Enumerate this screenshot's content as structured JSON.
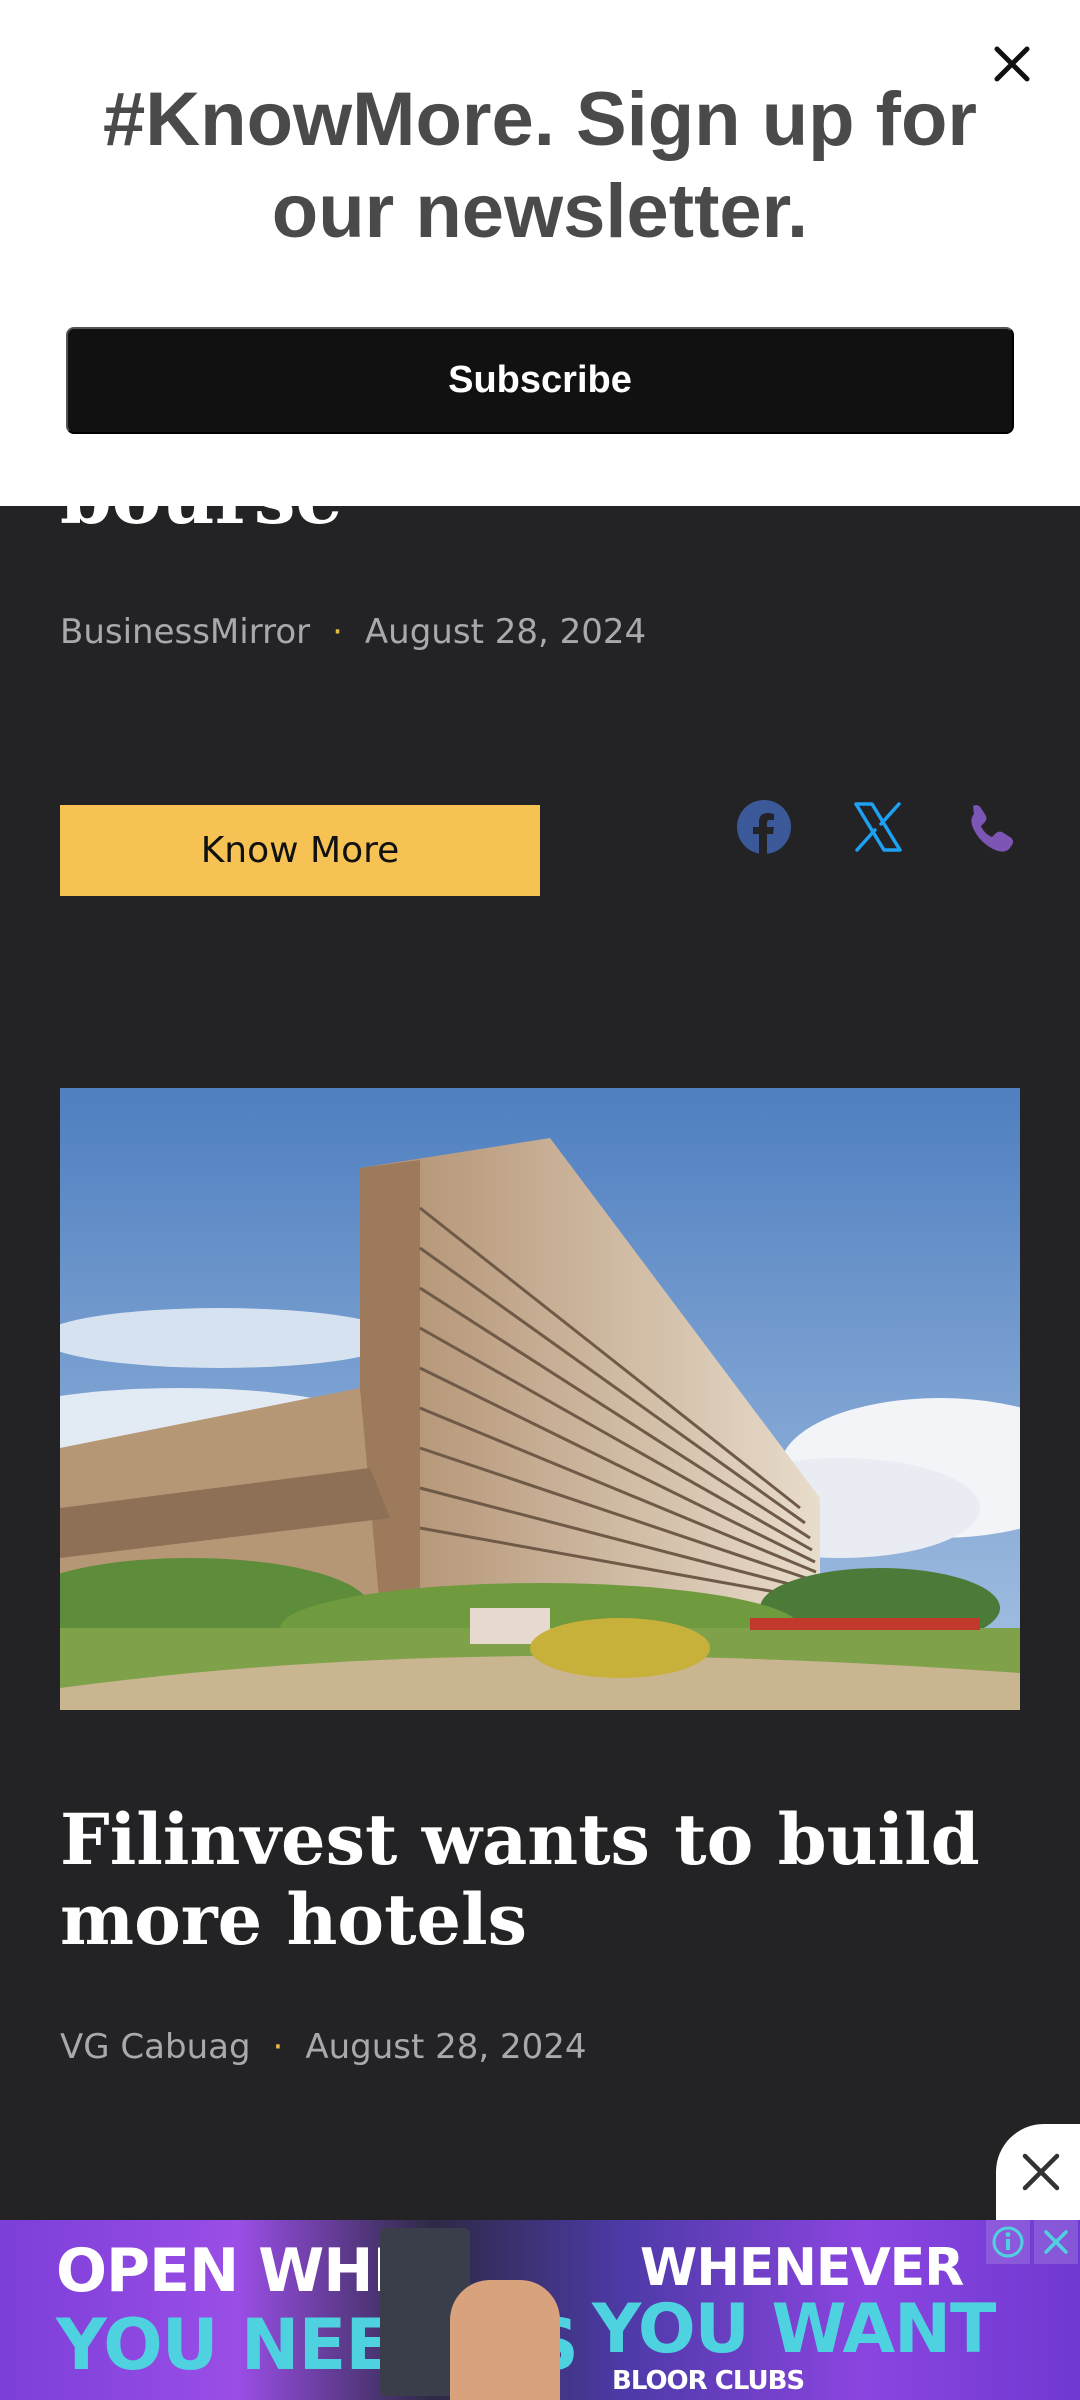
{
  "popup": {
    "heading": "#KnowMore. Sign up for our newsletter.",
    "subscribe_label": "Subscribe"
  },
  "previous_article": {
    "title_fragment": "bourse",
    "author": "BusinessMirror",
    "date": "August 28, 2024",
    "know_more_label": "Know More"
  },
  "share_icons": [
    "facebook-icon",
    "x-icon",
    "phone-icon"
  ],
  "article": {
    "title": "Filinvest wants to build more hotels",
    "author": "VG Cabuag",
    "date": "August 28, 2024"
  },
  "ad": {
    "line1_left": "OPEN WHEN",
    "line2_left": "YOU NEED US",
    "line1_right": "WHENEVER",
    "line2_right": "YOU WANT",
    "clubs_text": "BLOOR CLUBS"
  },
  "colors": {
    "background": "#232325",
    "accent_yellow": "#f5c253",
    "facebook": "#3b5998",
    "x": "#1da1f2",
    "phone": "#7d55b5"
  }
}
